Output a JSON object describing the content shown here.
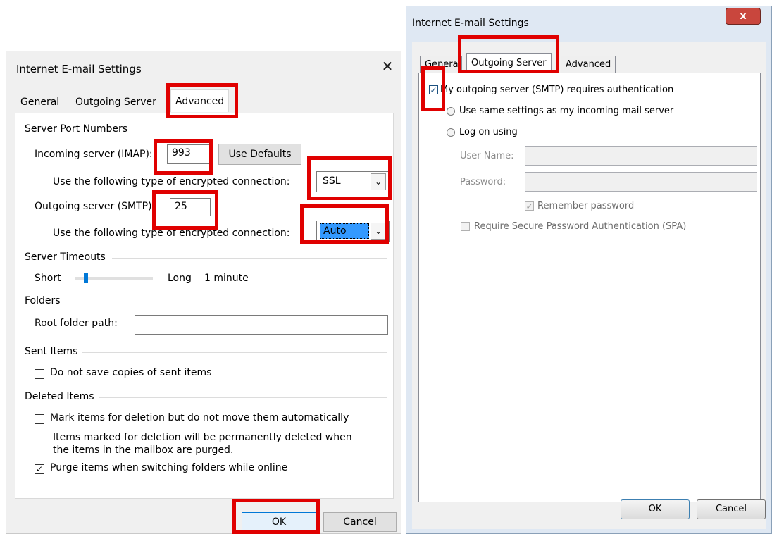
{
  "left_dialog": {
    "title": "Internet E-mail Settings",
    "close_glyph": "✕",
    "tabs": [
      {
        "label": "General"
      },
      {
        "label": "Outgoing Server"
      },
      {
        "label": "Advanced"
      }
    ],
    "server_ports": {
      "group_label": "Server Port Numbers",
      "incoming_label": "Incoming server (IMAP):",
      "incoming_value": "993",
      "use_defaults_label": "Use Defaults",
      "incoming_encryption_label": "Use the following type of encrypted connection:",
      "incoming_encryption_value": "SSL",
      "outgoing_label": "Outgoing server (SMTP):",
      "outgoing_value": "25",
      "outgoing_encryption_label": "Use the following type of encrypted connection:",
      "outgoing_encryption_value": "Auto"
    },
    "timeouts": {
      "group_label": "Server Timeouts",
      "short_label": "Short",
      "long_label": "Long",
      "value_label": "1 minute"
    },
    "folders": {
      "group_label": "Folders",
      "root_folder_label": "Root folder path:",
      "root_folder_value": ""
    },
    "sent_items": {
      "group_label": "Sent Items",
      "dont_save_label": "Do not save copies of sent items",
      "dont_save_checked": false
    },
    "deleted_items": {
      "group_label": "Deleted Items",
      "mark_label": "Mark items for deletion but do not move them automatically",
      "mark_checked": false,
      "note_line1": "Items marked for deletion will be permanently deleted when",
      "note_line2": "the items in the mailbox are purged.",
      "purge_label": "Purge items when switching folders while online",
      "purge_checked": true
    },
    "ok_label": "OK",
    "cancel_label": "Cancel"
  },
  "right_dialog": {
    "title": "Internet E-mail Settings",
    "close_glyph": "x",
    "tabs": [
      {
        "label": "General"
      },
      {
        "label": "Outgoing Server"
      },
      {
        "label": "Advanced"
      }
    ],
    "requires_auth_label": "My outgoing server (SMTP) requires authentication",
    "requires_auth_checked": true,
    "use_same_label": "Use same settings as my incoming mail server",
    "log_on_label": "Log on using",
    "username_label": "User Name:",
    "username_value": "",
    "password_label": "Password:",
    "password_value": "",
    "remember_label": "Remember password",
    "remember_checked": true,
    "spa_label": "Require Secure Password Authentication (SPA)",
    "spa_checked": false,
    "ok_label": "OK",
    "cancel_label": "Cancel"
  },
  "colors": {
    "highlight": "#e00000",
    "win7_close": "#c9463d",
    "selected_combo": "#3399ff"
  }
}
